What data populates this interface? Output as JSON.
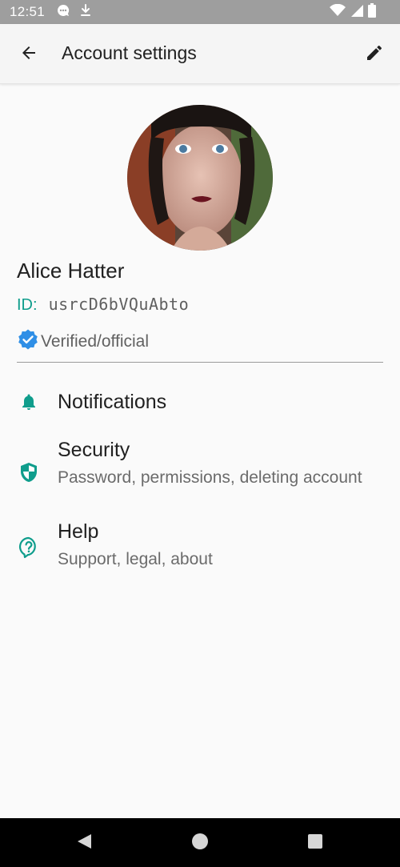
{
  "status_bar": {
    "time": "12:51",
    "icons_left": [
      "chat-bubble-icon",
      "download-icon"
    ],
    "icons_right": [
      "wifi-icon",
      "cell-signal-icon",
      "battery-icon"
    ]
  },
  "app_bar": {
    "title": "Account settings",
    "back_icon": "arrow-back-icon",
    "edit_icon": "pencil-icon"
  },
  "profile": {
    "name": "Alice Hatter",
    "id_label": "ID:",
    "id_value": "usrcD6bVQuAbto",
    "verified_label": "Verified/official",
    "avatar": "profile-photo"
  },
  "menu": [
    {
      "title": "Notifications",
      "subtitle": "",
      "icon": "bell-icon"
    },
    {
      "title": "Security",
      "subtitle": "Password, permissions, deleting account",
      "icon": "shield-icon"
    },
    {
      "title": "Help",
      "subtitle": "Support, legal, about",
      "icon": "help-circle-icon"
    }
  ],
  "nav_bar": {
    "buttons": [
      "back-triangle-icon",
      "home-circle-icon",
      "recents-square-icon"
    ]
  },
  "colors": {
    "accent": "#0f9d8c",
    "verified_badge": "#2f8fe6",
    "status_bar": "#9e9e9e",
    "app_bar": "#f5f5f5",
    "background": "#fafafa"
  }
}
